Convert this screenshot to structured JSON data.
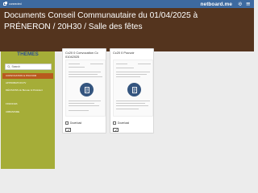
{
  "topbar": {
    "user_label": "connected",
    "brand": "netboard.me",
    "icons": [
      "lock-icon",
      "gear-icon",
      "menu-icon"
    ]
  },
  "header": {
    "title": "Documents Conseil Communautaire du 01/04/2025 à PRÉNERON / 20H30 / Salle des fêtes"
  },
  "sidebar": {
    "title": "THEMES",
    "search_placeholder": "Search",
    "items": [
      {
        "label": "CONVOCATION & POUVOIR"
      },
      {
        "label": "APPROBATION PV"
      },
      {
        "label": "DÉCISIONS du Bureau & Président"
      },
      {
        "label": "FINANCES"
      },
      {
        "label": "URBANISME"
      }
    ]
  },
  "cards": [
    {
      "title": "Cc20 0 Convocation Cc 01042025",
      "download": "Download"
    },
    {
      "title": "Cc20 0 Pouvoir",
      "download": "Download"
    }
  ],
  "colors": {
    "topbar": "#3d6aa0",
    "header": "#54341e",
    "sidebar": "#a5ad38",
    "active_item": "#b85a1e",
    "sidebar_title": "#2d4f8f",
    "badge": "#34557f"
  }
}
